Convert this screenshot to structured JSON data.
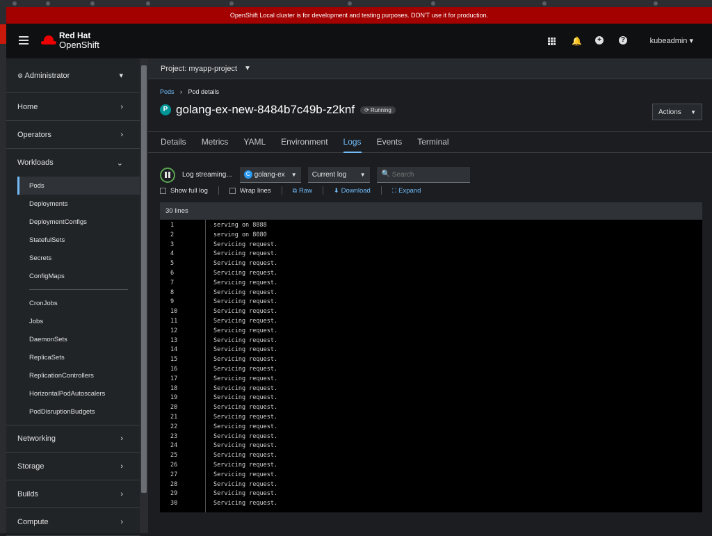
{
  "banner": "OpenShift Local cluster is for development and testing purposes. DON'T use it for production.",
  "brand": {
    "line1": "Red Hat",
    "line2": "OpenShift"
  },
  "user": "kubeadmin ▾",
  "masthead_icons": [
    "apps-grid-icon",
    "bell-icon",
    "plus-circle-icon",
    "help-icon"
  ],
  "sidebar": {
    "perspective": "Administrator",
    "sections": [
      {
        "label": "Home"
      },
      {
        "label": "Operators"
      },
      {
        "label": "Workloads"
      }
    ],
    "workloads": [
      "Pods",
      "Deployments",
      "DeploymentConfigs",
      "StatefulSets",
      "Secrets",
      "ConfigMaps"
    ],
    "workloads2": [
      "CronJobs",
      "Jobs",
      "DaemonSets",
      "ReplicaSets",
      "ReplicationControllers",
      "HorizontalPodAutoscalers",
      "PodDisruptionBudgets"
    ],
    "bottom_sections": [
      {
        "label": "Networking"
      },
      {
        "label": "Storage"
      },
      {
        "label": "Builds"
      },
      {
        "label": "Compute"
      }
    ]
  },
  "project": "Project: myapp-project",
  "breadcrumb": {
    "parent": "Pods",
    "current": "Pod details"
  },
  "pod": {
    "badge": "P",
    "name": "golang-ex-new-8484b7c49b-z2knf",
    "status": "Running"
  },
  "actions_label": "Actions",
  "tabs": [
    "Details",
    "Metrics",
    "YAML",
    "Environment",
    "Logs",
    "Events",
    "Terminal"
  ],
  "active_tab": "Logs",
  "log_toolbar": {
    "streaming": "Log streaming...",
    "container_badge": "C",
    "container": "golang-ex",
    "log_select": "Current log",
    "search_placeholder": "Search",
    "show_full_log": "Show full log",
    "wrap_lines": "Wrap lines",
    "raw": "Raw",
    "download": "Download",
    "expand": "Expand"
  },
  "log": {
    "line_count": "30 lines",
    "lines": [
      "serving on 8888",
      "serving on 8080",
      "Servicing request.",
      "Servicing request.",
      "Servicing request.",
      "Servicing request.",
      "Servicing request.",
      "Servicing request.",
      "Servicing request.",
      "Servicing request.",
      "Servicing request.",
      "Servicing request.",
      "Servicing request.",
      "Servicing request.",
      "Servicing request.",
      "Servicing request.",
      "Servicing request.",
      "Servicing request.",
      "Servicing request.",
      "Servicing request.",
      "Servicing request.",
      "Servicing request.",
      "Servicing request.",
      "Servicing request.",
      "Servicing request.",
      "Servicing request.",
      "Servicing request.",
      "Servicing request.",
      "Servicing request.",
      "Servicing request."
    ]
  },
  "colors": {
    "banner": "#a30000",
    "accent": "#73bcf7",
    "brand_red": "#ee0000",
    "pod_badge": "#009596",
    "stream_ring": "#5ba352"
  }
}
